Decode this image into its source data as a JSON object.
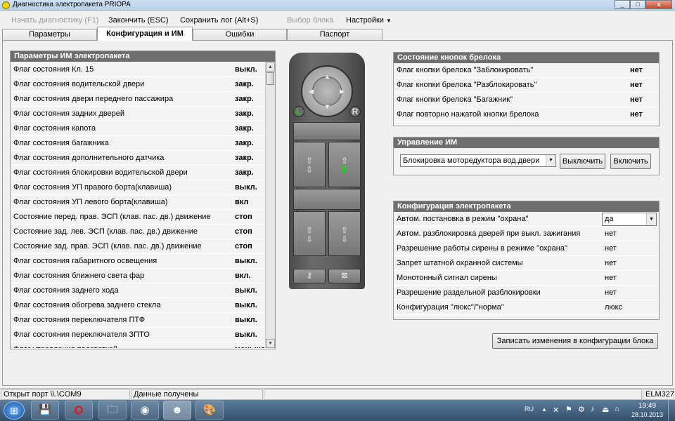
{
  "window": {
    "title": "Диагностика электропакета PRIOPA",
    "min": "_",
    "max": "□",
    "close": "x"
  },
  "menu": {
    "start": "Начать диагностику (F1)",
    "finish": "Закончить (ESC)",
    "save_log": "Сохранить лог (Alt+S)",
    "select_block": "Выбор блока",
    "settings": "Настройки"
  },
  "tabs": [
    "Параметры",
    "Конфигурация и ИМ",
    "Ошибки",
    "Паспорт"
  ],
  "params": {
    "title": "Параметры ИМ электропакета",
    "rows": [
      {
        "label": "Флаг состояния Кл. 15",
        "value": "выкл."
      },
      {
        "label": "Флаг состояния водительской двери",
        "value": "закр."
      },
      {
        "label": "Флаг состояния двери переднего пассажира",
        "value": "закр."
      },
      {
        "label": "Флаг состояния задних дверей",
        "value": "закр."
      },
      {
        "label": "Флаг состояния капота",
        "value": "закр."
      },
      {
        "label": "Флаг состояния багажника",
        "value": "закр."
      },
      {
        "label": "Флаг состояния дополнительного датчика",
        "value": "закр."
      },
      {
        "label": "Флаг состояния блокировки водительской двери",
        "value": "закр."
      },
      {
        "label": "Флаг состояния УП правого борта(клавиша)",
        "value": "выкл."
      },
      {
        "label": "Флаг состояния УП левого борта(клавиша)",
        "value": "вкл"
      },
      {
        "label": "Состояние перед. прав. ЭСП (клав. пас. дв.) движение",
        "value": "стоп"
      },
      {
        "label": "Состояние зад. лев. ЭСП (клав. пас. дв.) движение",
        "value": "стоп"
      },
      {
        "label": "Состояние зад. прав. ЭСП (клав. пас. дв.) движение",
        "value": "стоп"
      },
      {
        "label": "Флаг состояния габаритного освещения",
        "value": "выкл."
      },
      {
        "label": "Флаг состояния ближнего света фар",
        "value": "вкл."
      },
      {
        "label": "Флаг состояния заднего хода",
        "value": "выкл."
      },
      {
        "label": "Флаг состояния обогрева заднего стекла",
        "value": "выкл."
      },
      {
        "label": "Флаг состояния переключателя ПТФ",
        "value": "выкл."
      },
      {
        "label": "Флаг состояния переключателя ЗПТО",
        "value": "выкл."
      },
      {
        "label": "Флаг управления подсветкой",
        "value": "меньше"
      }
    ]
  },
  "fob": {
    "letter_l": "L",
    "letter_r": "R"
  },
  "keyfob_state": {
    "title": "Состояние кнопок брелока",
    "rows": [
      {
        "label": "Флаг кнопки брелока \"Заблокировать\"",
        "value": "нет"
      },
      {
        "label": "Флаг кнопки брелока \"Разблокировать\"",
        "value": "нет"
      },
      {
        "label": "Флаг кнопки брелока \"Багажник\"",
        "value": "нет"
      },
      {
        "label": "Флаг повторно нажатой кнопки брелока",
        "value": "нет"
      }
    ]
  },
  "control": {
    "title": "Управление ИМ",
    "select_value": "Блокировка моторедуктора вод.двери",
    "off_button": "Выключить",
    "on_button": "Включить"
  },
  "config": {
    "title": "Конфигурация электропакета",
    "rows": [
      {
        "label": "Автом. постановка в режим \"охрана\"",
        "value": "да"
      },
      {
        "label": "Автом. разблокировка дверей при выкл. зажигания",
        "value": "нет"
      },
      {
        "label": "Разрешение работы сирены в режиме \"охрана\"",
        "value": "нет"
      },
      {
        "label": "Запрет штатной охранной системы",
        "value": "нет"
      },
      {
        "label": "Монотонный сигнал сирены",
        "value": "нет"
      },
      {
        "label": "Разрешение раздельной разблокировки",
        "value": "нет"
      },
      {
        "label": "Конфигурация \"люкс\"/\"норма\"",
        "value": "люкс"
      }
    ],
    "write_button": "Записать изменения в конфигурации блока"
  },
  "status": {
    "port": "Открыт порт \\\\.\\COM9",
    "message": "Данные получены",
    "adapter": "ELM327"
  },
  "taskbar": {
    "lang": "RU",
    "time": "19:49",
    "date": "28.10.2013"
  }
}
